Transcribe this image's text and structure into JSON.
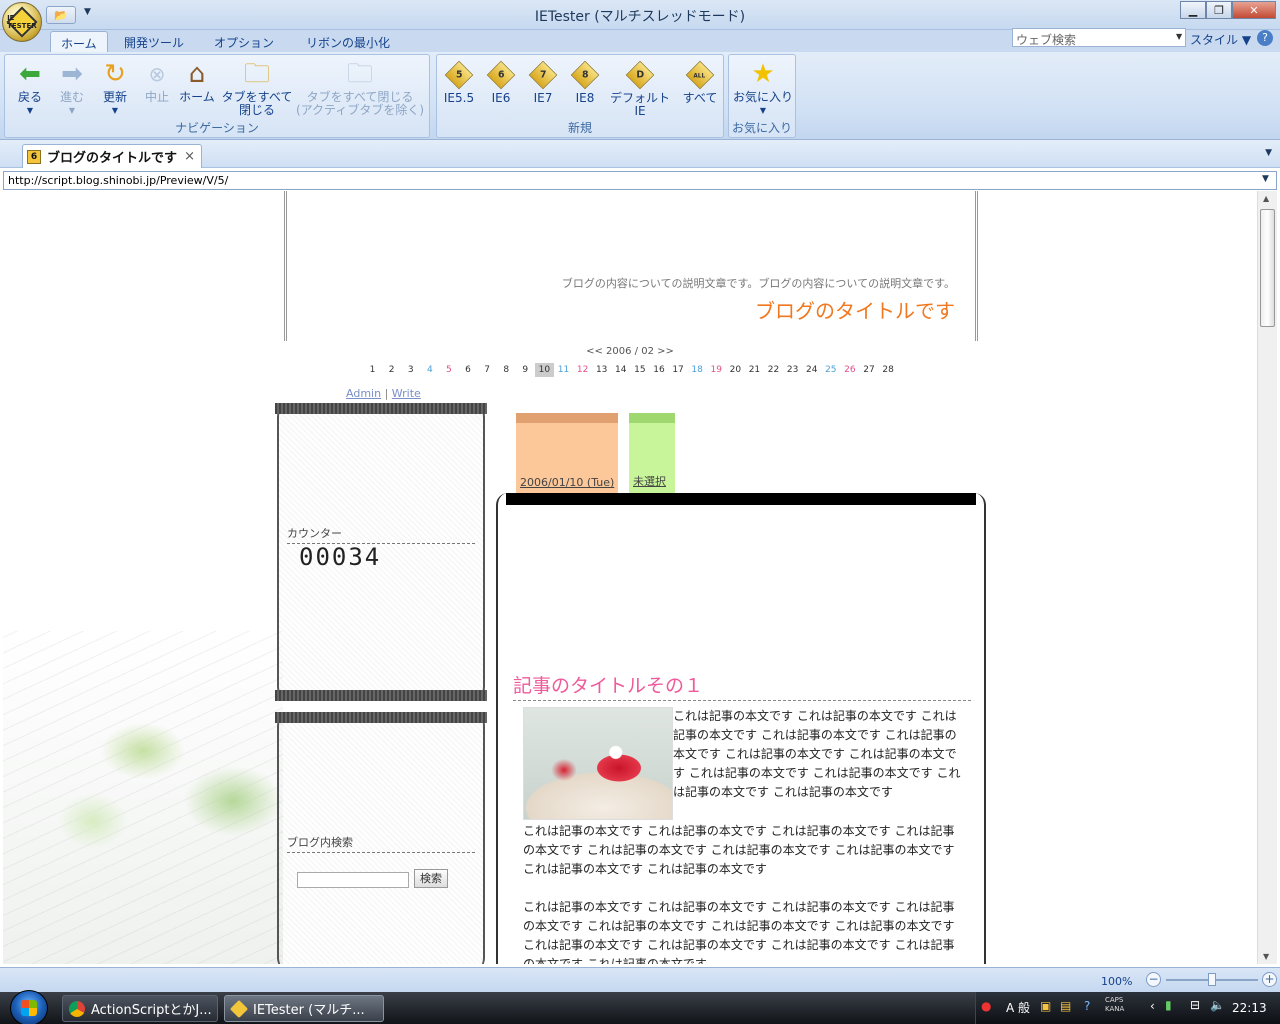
{
  "window": {
    "title": "IETester (マルチスレッドモード)",
    "orb_label": "IE TESTER",
    "minimize": "▁",
    "maximize": "❐",
    "close": "✕"
  },
  "ribbon_tabs": [
    "ホーム",
    "開発ツール",
    "オプション",
    "リボンの最小化"
  ],
  "search": {
    "placeholder": "ウェブ検索",
    "style_menu": "スタイル"
  },
  "navigation": {
    "label": "ナビゲーション",
    "back": "戻る",
    "forward": "進む",
    "refresh": "更新",
    "stop": "中止",
    "home": "ホーム",
    "close_all_1": "タブをすべて",
    "close_all_2": "閉じる",
    "close_all_except_1": "タブをすべて閉じる",
    "close_all_except_2": "(アクティブタブを除く)"
  },
  "new_group": {
    "label": "新規",
    "ie55": "IE5.5",
    "ie6": "IE6",
    "ie7": "IE7",
    "ie8": "IE8",
    "default": "デフォルトIE",
    "all": "すべて",
    "ie55_num": "5",
    "ie6_num": "6",
    "ie7_num": "7",
    "ie8_num": "8",
    "default_num": "D",
    "all_num": "ALL"
  },
  "favorites": {
    "label": "お気に入り",
    "button": "お気に入り"
  },
  "doc_tab": {
    "title": "ブログのタイトルです",
    "icon_num": "6",
    "close": "×"
  },
  "address": "http://script.blog.shinobi.jp/Preview/V/5/",
  "blog": {
    "description": "ブログの内容についての説明文章です。ブログの内容についての説明文章です。",
    "title": "ブログのタイトルです",
    "calendar_nav": "<< 2006 / 02 >>",
    "calendar_days": [
      "1",
      "2",
      "3",
      "4",
      "5",
      "6",
      "7",
      "8",
      "9",
      "10",
      "11",
      "12",
      "13",
      "14",
      "15",
      "16",
      "17",
      "18",
      "19",
      "20",
      "21",
      "22",
      "23",
      "24",
      "25",
      "26",
      "27",
      "28"
    ],
    "admin": "Admin",
    "separator": "|",
    "write": "Write",
    "counter_heading": "カウンター",
    "counter_value": "00034",
    "search_heading": "ブログ内検索",
    "search_button": "検索",
    "date_tab": "2006/01/10 (Tue)",
    "category_tab": "未選択",
    "post_title": "記事のタイトルその１",
    "post_text_1": "これは記事の本文です これは記事の本文です これは記事の本文です これは記事の本文です これは記事の本文です これは記事の本文です これは記事の本文です これは記事の本文です これは記事の本文です これは記事の本文です これは記事の本文です",
    "post_text_2": "これは記事の本文です これは記事の本文です これは記事の本文です これは記事の本文です これは記事の本文です これは記事の本文です これは記事の本文です これは記事の本文です これは記事の本文です",
    "post_text_3": "これは記事の本文です これは記事の本文です これは記事の本文です これは記事の本文です これは記事の本文です これは記事の本文です これは記事の本文です これは記事の本文です これは記事の本文です これは記事の本文です これは記事の本文です これは記事の本文です"
  },
  "statusbar": {
    "zoom": "100%",
    "zoom_minus": "−",
    "zoom_plus": "+"
  },
  "taskbar": {
    "items": [
      "ActionScriptとかJ...",
      "IETester (マルチ..."
    ],
    "clock": "22:13",
    "ime_mode": "A 般",
    "caps": "CAPS",
    "kana": "KANA"
  },
  "colors": {
    "blog_title": "#f07820",
    "post_title": "#ee5a9a",
    "date_tab": "#fcc89a",
    "category_tab": "#c8f59a"
  }
}
